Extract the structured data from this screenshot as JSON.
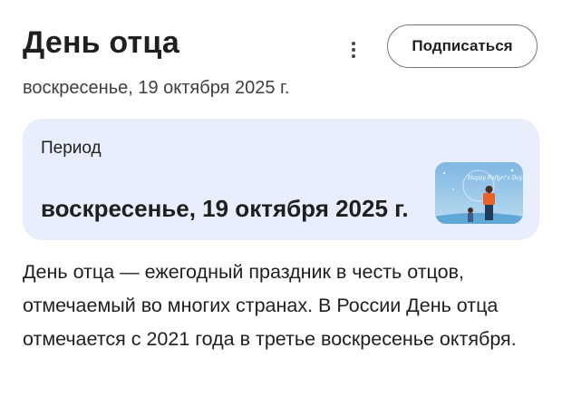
{
  "header": {
    "title": "День отца",
    "date": "воскресенье, 19 октября 2025 г.",
    "subscribe_label": "Подписаться",
    "more_icon": "more-vert-icon"
  },
  "period_card": {
    "label": "Период",
    "value": "воскресенье, 19 октября 2025 г.",
    "thumbnail_text": "Happy Father's Day"
  },
  "description": "День отца — ежегодный праздник в честь отцов, отмечаемый во многих странах. В России День отца отмечается с 2021 года в третье воскресенье октября.",
  "colors": {
    "card_background": "#e8eefc",
    "thumbnail_sky": "#8ec3e8"
  }
}
